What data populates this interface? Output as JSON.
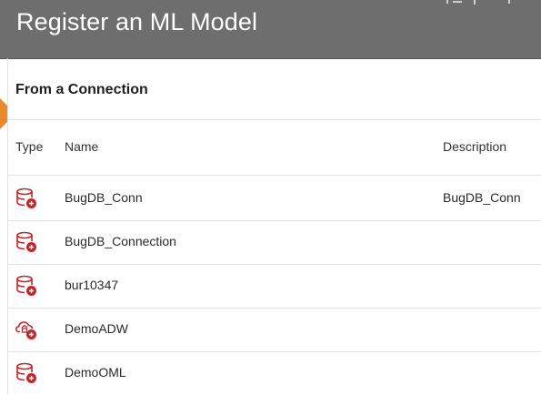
{
  "header": {
    "title": "Register an ML Model"
  },
  "section": {
    "title": "From a Connection"
  },
  "table": {
    "columns": {
      "type": "Type",
      "name": "Name",
      "description": "Description"
    },
    "rows": [
      {
        "icon": "database-connection-icon",
        "name": "BugDB_Conn",
        "description": "BugDB_Conn"
      },
      {
        "icon": "database-connection-icon",
        "name": "BugDB_Connection",
        "description": ""
      },
      {
        "icon": "database-connection-icon",
        "name": "bur10347",
        "description": ""
      },
      {
        "icon": "cloud-connection-icon",
        "name": "DemoADW",
        "description": ""
      },
      {
        "icon": "database-connection-icon",
        "name": "DemoOML",
        "description": ""
      }
    ]
  },
  "colors": {
    "header_bg": "#6e6e6e",
    "icon_red": "#c0282d",
    "accent_orange": "#e8892c"
  }
}
